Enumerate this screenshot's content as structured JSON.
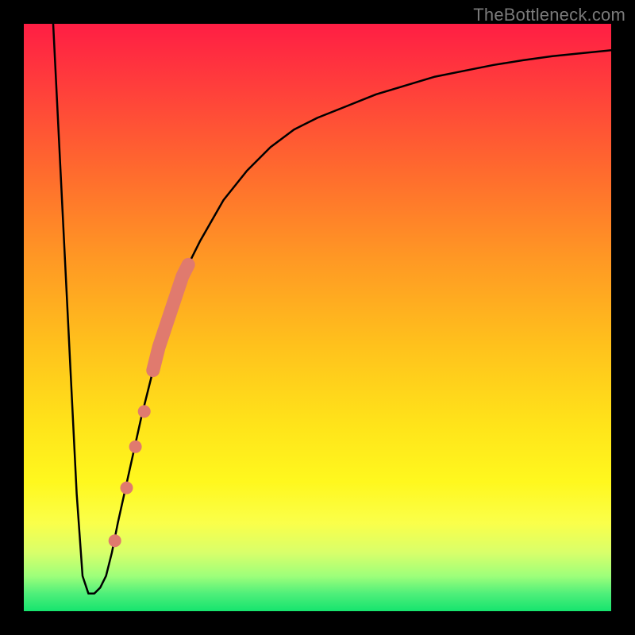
{
  "watermark": "TheBottleneck.com",
  "chart_data": {
    "type": "line",
    "title": "",
    "xlabel": "",
    "ylabel": "",
    "xlim": [
      0,
      100
    ],
    "ylim": [
      0,
      100
    ],
    "grid": false,
    "series": [
      {
        "name": "curve",
        "color": "#000000",
        "x": [
          5,
          6,
          7,
          8,
          9,
          10,
          11,
          12,
          13,
          14,
          15,
          16,
          18,
          20,
          22,
          24,
          26,
          28,
          30,
          34,
          38,
          42,
          46,
          50,
          55,
          60,
          65,
          70,
          75,
          80,
          85,
          90,
          95,
          100
        ],
        "y": [
          100,
          80,
          60,
          40,
          20,
          6,
          3,
          3,
          4,
          6,
          10,
          15,
          24,
          33,
          41,
          48,
          54,
          59,
          63,
          70,
          75,
          79,
          82,
          84,
          86,
          88,
          89.5,
          91,
          92,
          93,
          93.8,
          94.5,
          95,
          95.5
        ]
      }
    ],
    "highlight_band": {
      "name": "thick-red-band",
      "color": "#e07a6e",
      "x": [
        22,
        23,
        24,
        25,
        26,
        27,
        28
      ],
      "y": [
        41,
        45,
        48,
        51,
        54,
        57,
        59
      ]
    },
    "dots": {
      "name": "red-dots",
      "color": "#e07a6e",
      "points": [
        {
          "x": 15.5,
          "y": 12
        },
        {
          "x": 17.5,
          "y": 21
        },
        {
          "x": 19.0,
          "y": 28
        },
        {
          "x": 20.5,
          "y": 34
        }
      ]
    }
  }
}
